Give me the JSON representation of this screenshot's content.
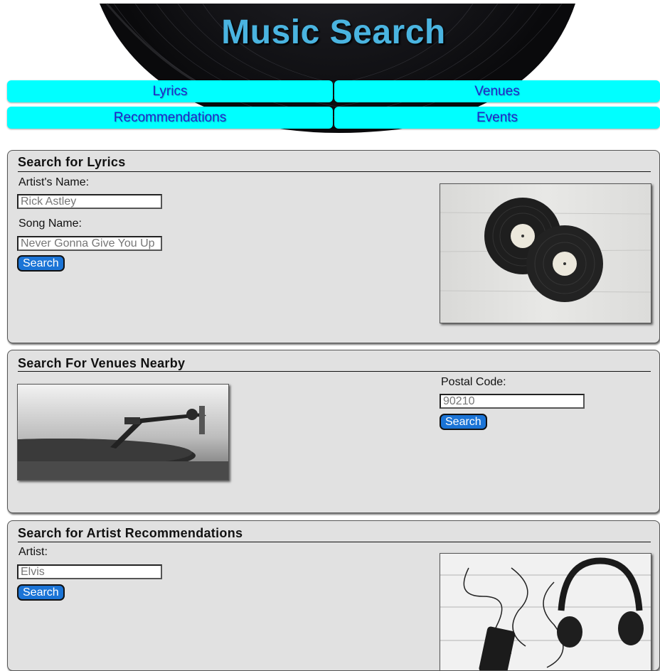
{
  "header": {
    "title": "Music Search"
  },
  "nav": {
    "lyrics": "Lyrics",
    "venues": "Venues",
    "recommendations": "Recommendations",
    "events": "Events"
  },
  "lyrics_section": {
    "title": "Search for Lyrics",
    "artist_label": "Artist's Name:",
    "artist_placeholder": "Rick Astley",
    "song_label": "Song Name:",
    "song_placeholder": "Never Gonna Give You Up",
    "search_label": "Search",
    "image": "vinyl-records-photo"
  },
  "venues_section": {
    "title": "Search For Venues Nearby",
    "postal_label": "Postal Code:",
    "postal_placeholder": "90210",
    "search_label": "Search",
    "image": "turntable-photo"
  },
  "recs_section": {
    "title": "Search for Artist Recommendations",
    "artist_label": "Artist:",
    "artist_placeholder": "Elvis",
    "search_label": "Search",
    "image": "headphones-photo"
  },
  "colors": {
    "title": "#4ab4e0",
    "nav_bg": "#00ffff",
    "nav_text": "#2222cc",
    "section_bg": "#e1e1e1",
    "button_bg": "#1b74d6"
  }
}
